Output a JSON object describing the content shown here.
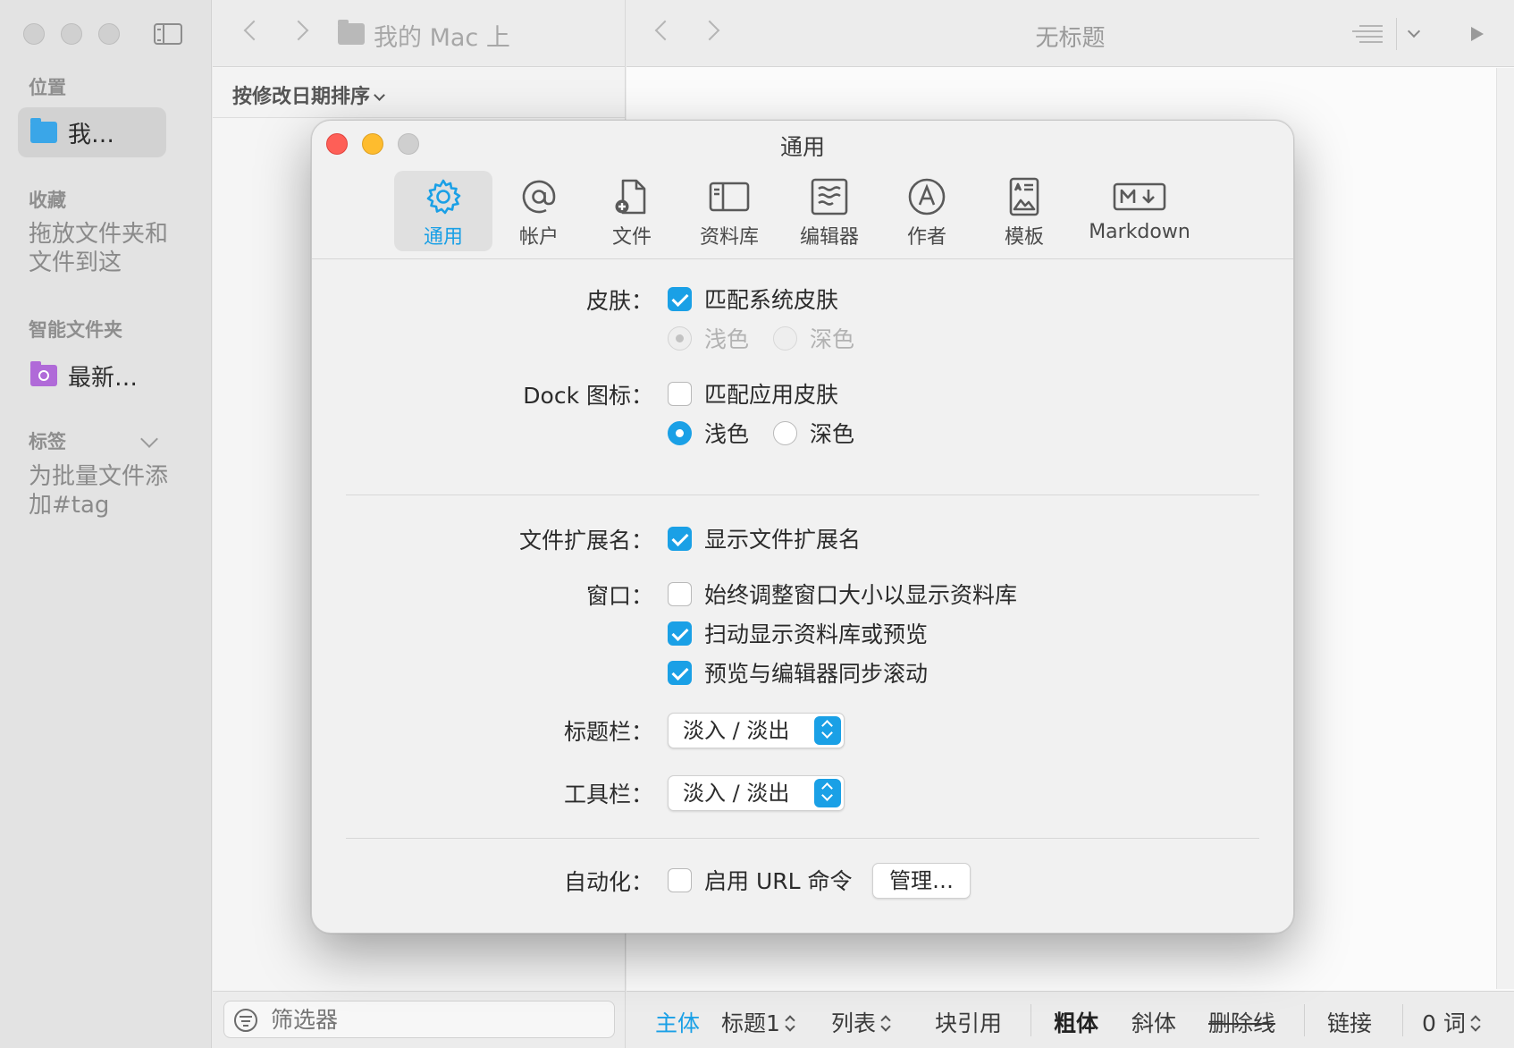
{
  "sidebar": {
    "location_title": "位置",
    "location_item": "我…",
    "favorites_title": "收藏",
    "favorites_hint": "拖放文件夹和文件到这",
    "smart_title": "智能文件夹",
    "smart_item": "最新…",
    "tags_title": "标签",
    "tags_hint": "为批量文件添加#tag"
  },
  "file_list": {
    "path_label": "我的 Mac 上",
    "sort_label": "按修改日期排序",
    "filter_placeholder": "筛选器"
  },
  "editor": {
    "title": "无标题"
  },
  "format_bar": {
    "body": "主体",
    "heading": "标题1",
    "list": "列表",
    "blockquote": "块引用",
    "bold": "粗体",
    "italic": "斜体",
    "strikethrough": "删除线",
    "link": "链接",
    "word_count": "0 词"
  },
  "dialog": {
    "title": "通用",
    "tabs": [
      {
        "label": "通用",
        "icon": "gear-icon",
        "active": true
      },
      {
        "label": "帐户",
        "icon": "at-icon",
        "active": false
      },
      {
        "label": "文件",
        "icon": "new-file-icon",
        "active": false
      },
      {
        "label": "资料库",
        "icon": "library-icon",
        "active": false
      },
      {
        "label": "编辑器",
        "icon": "editor-icon",
        "active": false
      },
      {
        "label": "作者",
        "icon": "author-icon",
        "active": false
      },
      {
        "label": "模板",
        "icon": "template-icon",
        "active": false
      },
      {
        "label": "Markdown",
        "icon": "markdown-icon",
        "active": false
      }
    ],
    "skin": {
      "label": "皮肤：",
      "match_system": "匹配系统皮肤",
      "match_system_checked": true,
      "light": "浅色",
      "dark": "深色"
    },
    "dock": {
      "label": "Dock 图标：",
      "match_app": "匹配应用皮肤",
      "match_app_checked": false,
      "light": "浅色",
      "dark": "深色"
    },
    "extension": {
      "label": "文件扩展名：",
      "show_ext": "显示文件扩展名",
      "checked": true
    },
    "window": {
      "label": "窗口：",
      "opt1": "始终调整窗口大小以显示资料库",
      "opt2": "扫动显示资料库或预览",
      "opt3": "预览与编辑器同步滚动"
    },
    "titlebar": {
      "label": "标题栏：",
      "value": "淡入 / 淡出"
    },
    "toolbar": {
      "label": "工具栏：",
      "value": "淡入 / 淡出"
    },
    "automation": {
      "label": "自动化：",
      "enable_url": "启用 URL 命令",
      "manage": "管理…"
    }
  },
  "colors": {
    "accent": "#1aa0e6",
    "close": "#fe5f57",
    "minimize": "#febc2e"
  }
}
